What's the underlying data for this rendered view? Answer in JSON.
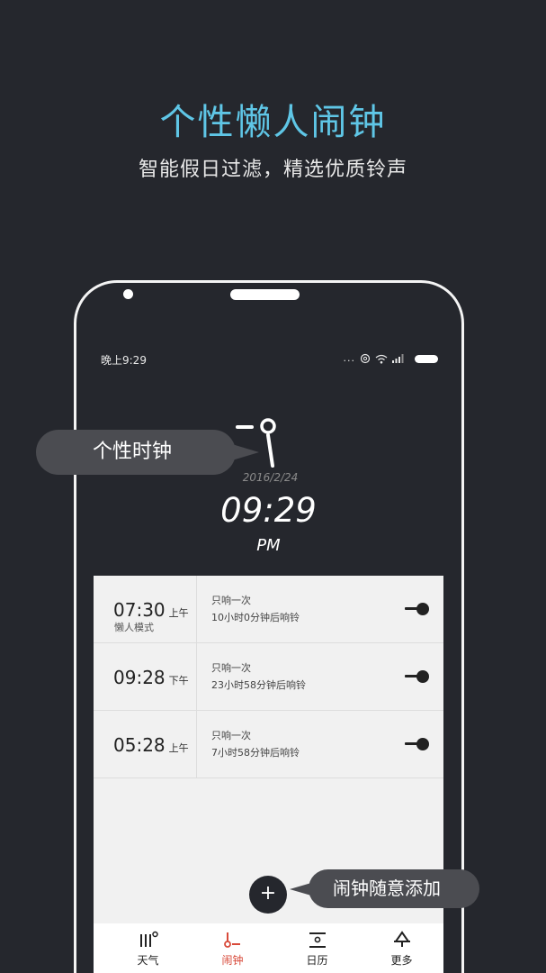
{
  "hero": {
    "title": "个性懒人闹钟",
    "subtitle": "智能假日过滤，精选优质铃声"
  },
  "status_bar": {
    "time": "晚上9:29",
    "dots": "...",
    "icons": [
      "alarm-icon",
      "wifi-icon",
      "signal-icon",
      "battery-icon"
    ]
  },
  "clock": {
    "date": "2016/2/24",
    "time": "09:29",
    "ampm": "PM"
  },
  "alarms": [
    {
      "time": "07:30",
      "ampm": "上午",
      "mode": "懒人模式",
      "repeat": "只响一次",
      "remaining": "10小时0分钟后响铃",
      "enabled": true
    },
    {
      "time": "09:28",
      "ampm": "下午",
      "mode": "",
      "repeat": "只响一次",
      "remaining": "23小时58分钟后响铃",
      "enabled": true
    },
    {
      "time": "05:28",
      "ampm": "上午",
      "mode": "",
      "repeat": "只响一次",
      "remaining": "7小时58分钟后响铃",
      "enabled": true
    }
  ],
  "fab": {
    "label": "+"
  },
  "callouts": {
    "clock": "个性时钟",
    "add": "闹钟随意添加"
  },
  "tabs": [
    {
      "label": "天气",
      "icon": "weather-icon",
      "active": false
    },
    {
      "label": "闹钟",
      "icon": "alarm-clock-icon",
      "active": true
    },
    {
      "label": "日历",
      "icon": "calendar-icon",
      "active": false
    },
    {
      "label": "更多",
      "icon": "more-icon",
      "active": false
    }
  ],
  "colors": {
    "background": "#25272d",
    "accent_title": "#5fc6e6",
    "active_tab": "#d84a3a",
    "panel": "#f1f1f1"
  }
}
